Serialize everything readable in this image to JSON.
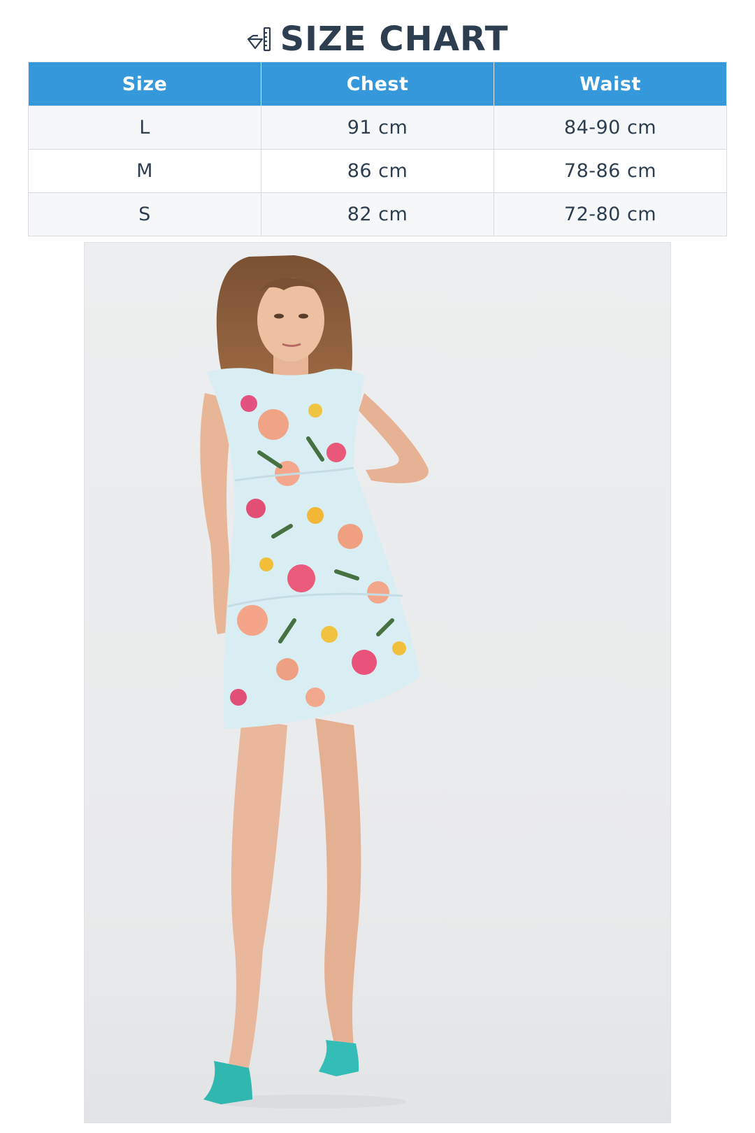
{
  "header": {
    "title": "SIZE CHART",
    "icon": "ruler-icon"
  },
  "size_table": {
    "columns": [
      "Size",
      "Chest",
      "Waist"
    ],
    "rows": [
      [
        "L",
        "91 cm",
        "84-90 cm"
      ],
      [
        "M",
        "86 cm",
        "78-86 cm"
      ],
      [
        "S",
        "82 cm",
        "72-80 cm"
      ]
    ]
  },
  "colors": {
    "header_bg": "#3498db",
    "title_text": "#2c3e50",
    "row_alt_bg": "#f6f7f8"
  },
  "product_photo": {
    "icon": "model-photo"
  }
}
